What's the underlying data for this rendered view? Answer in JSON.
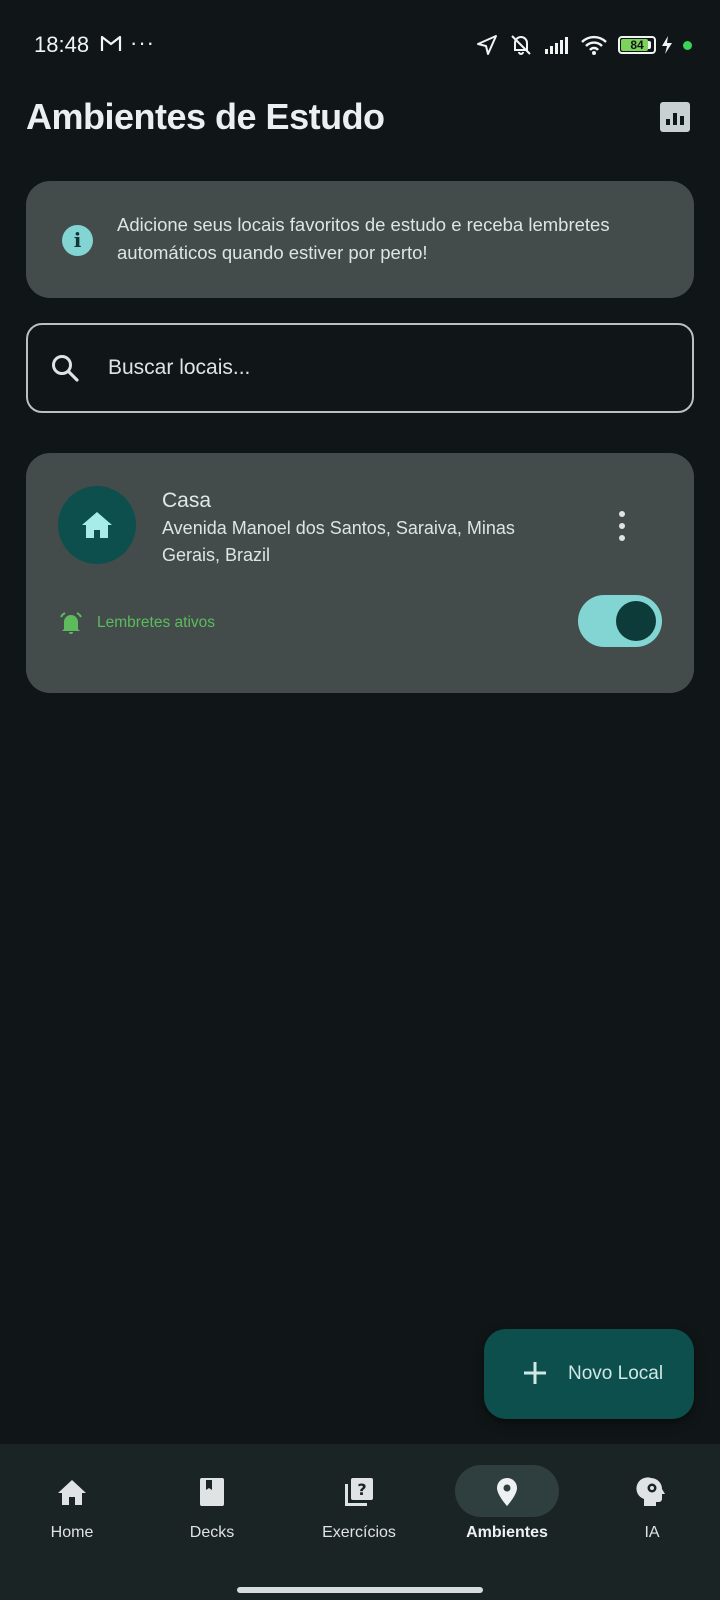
{
  "status_bar": {
    "time": "18:48",
    "more": "···",
    "battery_level": "84",
    "icons": [
      "gmail-icon",
      "location-arrow-icon",
      "notifications-muted-icon",
      "signal-icon",
      "wifi-icon",
      "battery-icon",
      "charging-icon",
      "privacy-dot-icon"
    ]
  },
  "header": {
    "title": "Ambientes de Estudo",
    "stats_icon": "bar-chart-icon"
  },
  "info_card": {
    "icon": "info-icon",
    "text": "Adicione seus locais favoritos de estudo e receba lembretes automáticos quando estiver por perto!"
  },
  "search": {
    "placeholder": "Buscar locais...",
    "value": ""
  },
  "locations": [
    {
      "icon": "home-icon",
      "name": "Casa",
      "address": "Avenida Manoel dos Santos, Saraiva, Minas Gerais, Brazil",
      "reminder_label": "Lembretes ativos",
      "reminders_enabled": true
    }
  ],
  "fab": {
    "label": "Novo Local",
    "icon": "plus-icon"
  },
  "bottom_nav": {
    "items": [
      {
        "label": "Home",
        "icon": "home-icon",
        "active": false
      },
      {
        "label": "Decks",
        "icon": "book-icon",
        "active": false
      },
      {
        "label": "Exercícios",
        "icon": "quiz-icon",
        "active": false
      },
      {
        "label": "Ambientes",
        "icon": "location-pin-icon",
        "active": true
      },
      {
        "label": "IA",
        "icon": "ai-head-icon",
        "active": false
      }
    ]
  },
  "colors": {
    "background": "#101617",
    "card": "#434c4b",
    "accent": "#82d5d3",
    "accent_dark": "#0d4f4d",
    "reminder_green": "#5dbb5d",
    "nav_background": "#1b2424"
  }
}
